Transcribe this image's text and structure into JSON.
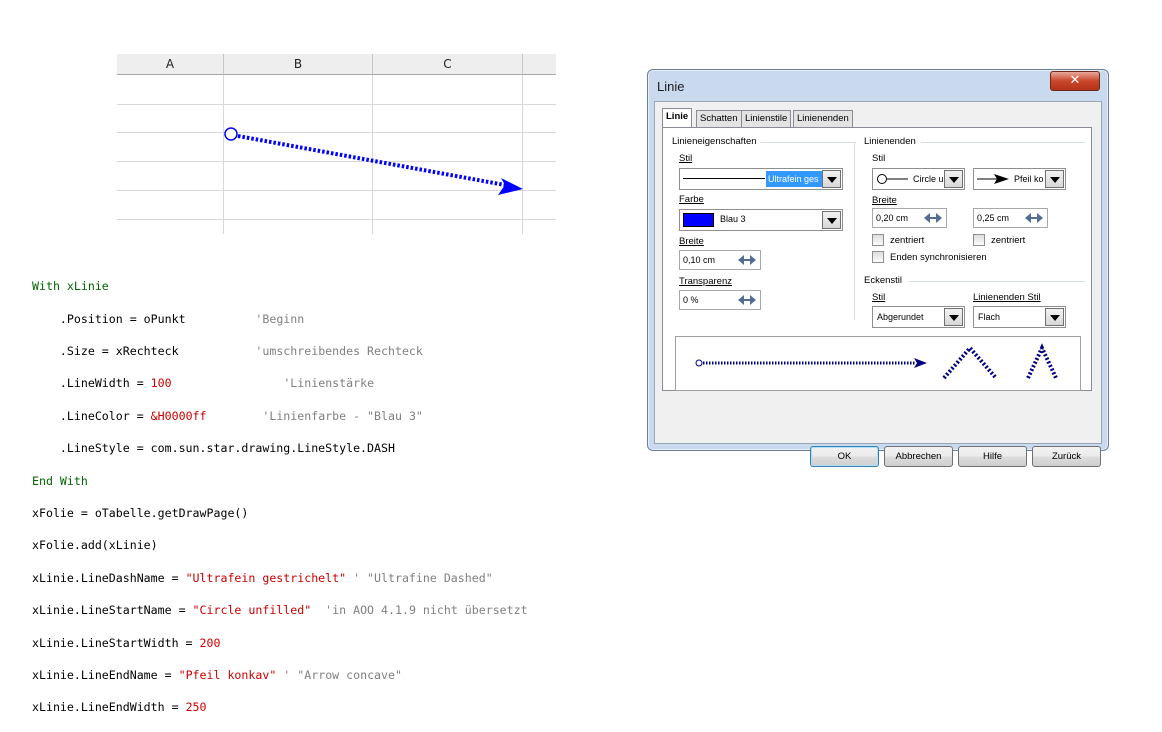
{
  "sheet": {
    "columns": [
      "A",
      "B",
      "C"
    ],
    "arrow_color": "#0000ff"
  },
  "code": {
    "l1": {
      "kw": "With",
      "obj": "xLinie"
    },
    "l2": {
      "prop": "    .Position = oPunkt          ",
      "cmt": "'Beginn"
    },
    "l3": {
      "prop": "    .Size = xRechteck           ",
      "cmt": "'umschreibendes Rechteck"
    },
    "l4": {
      "prop": "    .LineWidth = ",
      "num": "100",
      "pad": "                ",
      "cmt": "'Linienstärke"
    },
    "l5": {
      "prop": "    .LineColor = ",
      "num": "&H0000ff",
      "pad": "        ",
      "cmt": "'Linienfarbe - \"Blau 3\""
    },
    "l6": {
      "prop": "    .LineStyle = com.sun.star.drawing.LineStyle.DASH"
    },
    "l7": {
      "kw": "End With"
    },
    "l8": {
      "text": "xFolie = oTabelle.getDrawPage()"
    },
    "l9": {
      "text": "xFolie.add(xLinie)"
    },
    "l10": {
      "pre": "xLinie.LineDashName = ",
      "str": "\"Ultrafein gestrichelt\"",
      "cmt": " ' \"Ultrafine Dashed\""
    },
    "l11": {
      "pre": "xLinie.LineStartName = ",
      "str": "\"Circle unfilled\"",
      "cmt": "  'in AOO 4.1.9 nicht übersetzt"
    },
    "l12": {
      "pre": "xLinie.LineStartWidth = ",
      "num": "200"
    },
    "l13": {
      "pre": "xLinie.LineEndName = ",
      "str": "\"Pfeil konkav\"",
      "cmt": " ' \"Arrow concave\""
    },
    "l14": {
      "pre": "xLinie.LineEndWidth = ",
      "num": "250"
    }
  },
  "dialog": {
    "title": "Linie",
    "close_glyph": "✕",
    "tabs": [
      "Linie",
      "Schatten",
      "Linienstile",
      "Linienenden"
    ],
    "group_line_props": "Linieneigenschaften",
    "style_label": "Stil",
    "style_value": "Ultrafein ges",
    "color_label": "Farbe",
    "color_value": "Blau 3",
    "color_swatch": "#0000ff",
    "width_label": "Breite",
    "width_value": "0,10 cm",
    "transp_label": "Transparenz",
    "transp_value": "0 %",
    "group_line_ends": "Linienenden",
    "ends_style_label": "Stil",
    "start_value": "Circle u",
    "end_value": "Pfeil ko",
    "ends_width_label": "Breite",
    "start_width": "0,20 cm",
    "end_width": "0,25 cm",
    "centered_label": "zentriert",
    "sync_label": "Enden synchronisieren",
    "group_corner": "Eckenstil",
    "corner_style_label": "Stil",
    "cap_style_label": "Linienenden Stil",
    "corner_value": "Abgerundet",
    "cap_value": "Flach",
    "buttons": {
      "ok": "OK",
      "cancel": "Abbrechen",
      "help": "Hilfe",
      "back": "Zurück"
    }
  }
}
